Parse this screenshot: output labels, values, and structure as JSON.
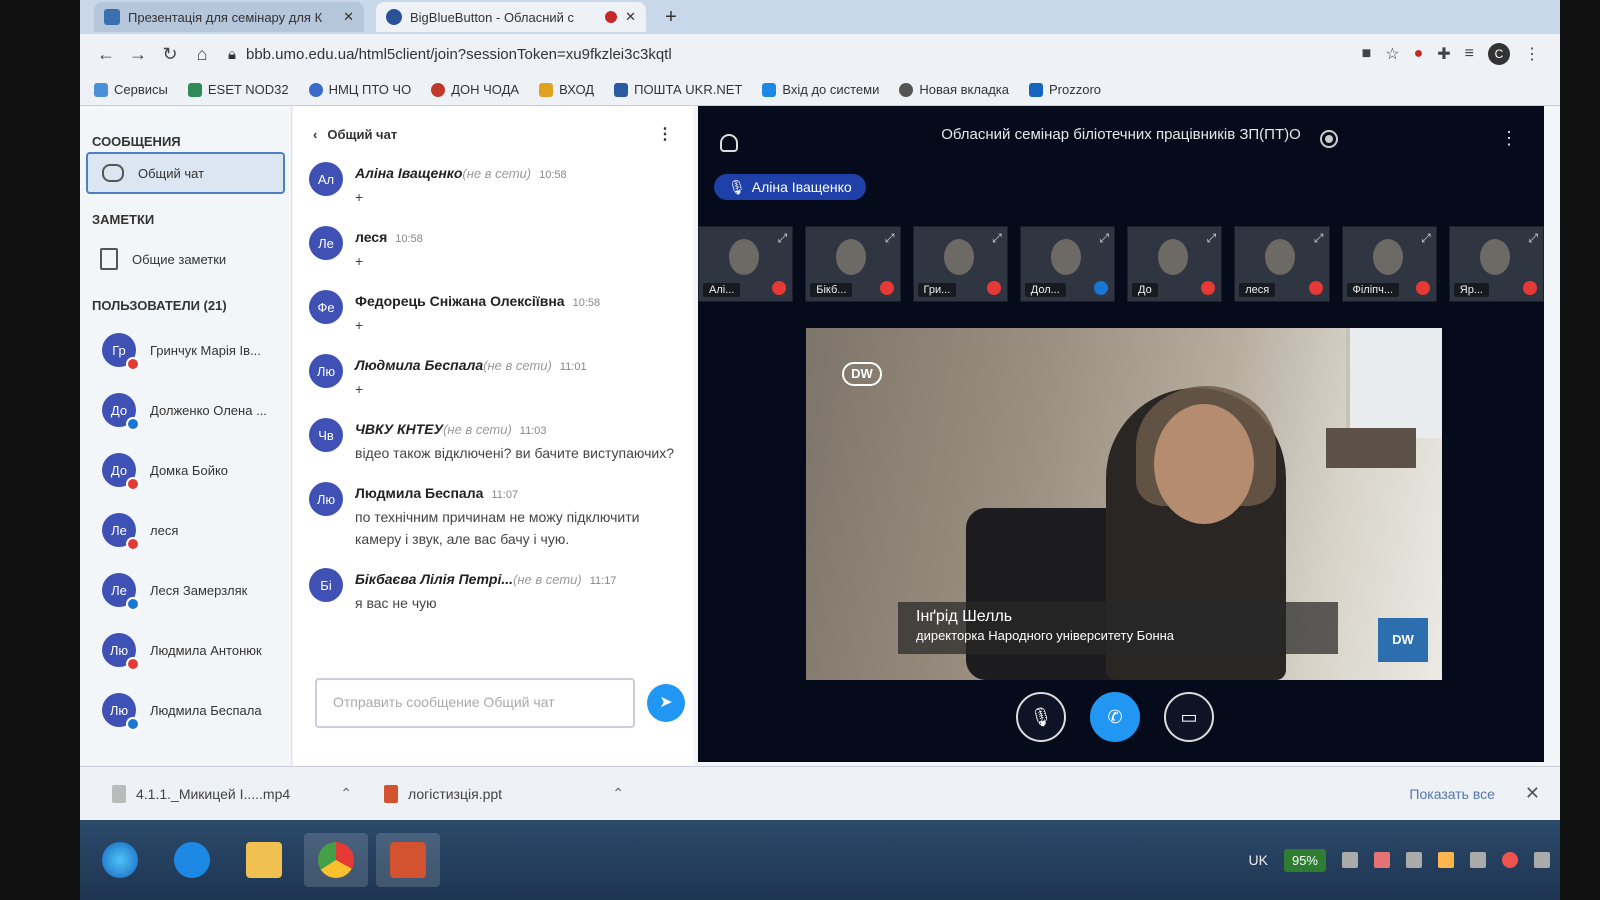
{
  "browser": {
    "tabs": [
      {
        "title": "Презентація для семінару для К",
        "active": false,
        "favicon_color": "#3b6fb0"
      },
      {
        "title": "BigBlueButton - Обласний с",
        "active": true,
        "favicon_color": "#2a5298"
      }
    ],
    "url": "bbb.umo.edu.ua/html5client/join?sessionToken=xu9fkzlei3c3kqtl",
    "profile_initial": "C",
    "bookmarks": [
      {
        "label": "Сервисы",
        "color": "#4a90d9"
      },
      {
        "label": "ESET NOD32",
        "color": "#2e8b57"
      },
      {
        "label": "НМЦ ПТО ЧО",
        "color": "#3a6bc9"
      },
      {
        "label": "ДОН ЧОДА",
        "color": "#c0392b"
      },
      {
        "label": "ВХОД",
        "color": "#e0a020"
      },
      {
        "label": "ПОШТА UKR.NET",
        "color": "#2c5aa0"
      },
      {
        "label": "Вхід до системи",
        "color": "#1e88e5"
      },
      {
        "label": "Новая вкладка",
        "color": "#555555"
      },
      {
        "label": "Prozzoro",
        "color": "#1565c0"
      }
    ]
  },
  "sidebar": {
    "messages_title": "СООБЩЕНИЯ",
    "public_chat": "Общий чат",
    "notes_title": "ЗАМЕТКИ",
    "shared_notes": "Общие заметки",
    "users_title": "ПОЛЬЗОВАТЕЛИ (21)",
    "users": [
      {
        "initials": "Гр",
        "name": "Гринчук Марія Ів...",
        "status_color": "#e53935"
      },
      {
        "initials": "До",
        "name": "Долженко Олена ...",
        "status_color": "#1976d2"
      },
      {
        "initials": "До",
        "name": "Домка Бойко",
        "status_color": "#e53935"
      },
      {
        "initials": "Ле",
        "name": "леся",
        "status_color": "#e53935"
      },
      {
        "initials": "Ле",
        "name": "Леся Замерзляк",
        "status_color": "#1976d2"
      },
      {
        "initials": "Лю",
        "name": "Людмила Антонюк",
        "status_color": "#e53935"
      },
      {
        "initials": "Лю",
        "name": "Людмила Беспала",
        "status_color": "#1976d2"
      }
    ]
  },
  "chat": {
    "title": "Общий чат",
    "messages": [
      {
        "initials": "Ал",
        "name": "Аліна Іващенко",
        "offline": "(не в сети)",
        "time": "10:58",
        "text": "+"
      },
      {
        "initials": "Ле",
        "name": "леся",
        "offline": "",
        "time": "10:58",
        "text": "+"
      },
      {
        "initials": "Фе",
        "name": "Федорець Сніжана Олексіївна",
        "offline": "",
        "time": "10:58",
        "text": "+"
      },
      {
        "initials": "Лю",
        "name": "Людмила Беспала",
        "offline": "(не в сети)",
        "time": "11:01",
        "text": "+"
      },
      {
        "initials": "Чв",
        "name": "ЧВКУ КНТЕУ",
        "offline": "(не в сети)",
        "time": "11:03",
        "text": "відео також відключені? ви бачите виступаючих?"
      },
      {
        "initials": "Лю",
        "name": "Людмила Беспала",
        "offline": "",
        "time": "11:07",
        "text": "по технічним причинам не можу підключити камеру і звук, але вас бачу і чую."
      },
      {
        "initials": "Бі",
        "name": "Бікбаєва Лілія Петрі...",
        "offline": "(не в сети)",
        "time": "11:17",
        "text": "я вас не чую"
      }
    ],
    "input_placeholder": "Отправить сообщение Общий чат"
  },
  "stage": {
    "title": "Обласний семінар біліотечних працівників ЗП(ПТ)О",
    "talking": "Аліна Іващенко",
    "thumbnails": [
      {
        "label": "Алі...",
        "muted": true
      },
      {
        "label": "Бікб...",
        "muted": true
      },
      {
        "label": "Гри...",
        "muted": true
      },
      {
        "label": "Дол...",
        "muted": false
      },
      {
        "label": "До",
        "muted": true
      },
      {
        "label": "леся",
        "muted": true
      },
      {
        "label": "Філіпч...",
        "muted": true
      },
      {
        "label": "Яр...",
        "muted": true
      }
    ],
    "video_caption_name": "Інґрід Шелль",
    "video_caption_role": "директорка Народного університету Бонна",
    "logo_text": "DW"
  },
  "downloads": {
    "items": [
      {
        "name": "4.1.1._Микицей І.....mp4"
      },
      {
        "name": "логістизція.ppt"
      }
    ],
    "show_all": "Показать все"
  },
  "taskbar": {
    "lang": "UK",
    "battery": "95%"
  }
}
